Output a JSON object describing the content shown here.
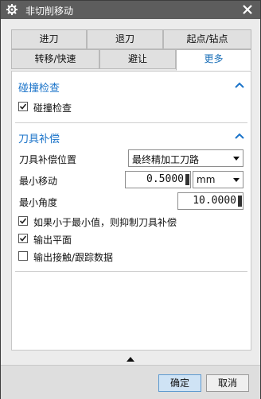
{
  "window": {
    "title": "非切削移动"
  },
  "icons": {
    "settings": "gear-icon",
    "close": "close-icon",
    "collapse": "chevron-up-icon",
    "dropdown": "chevron-down-icon"
  },
  "tabs": {
    "row1": [
      "进刀",
      "退刀",
      "起点/钻点"
    ],
    "row2": [
      "转移/快速",
      "避让",
      "更多"
    ],
    "active": "更多"
  },
  "collision_check": {
    "title": "碰撞检查",
    "checkbox_label": "碰撞检查",
    "checked": true
  },
  "tool_comp": {
    "title": "刀具补偿",
    "position_label": "刀具补偿位置",
    "position_value": "最终精加工刀路",
    "min_move_label": "最小移动",
    "min_move_value": "0.5000",
    "min_move_unit": "mm",
    "min_angle_label": "最小角度",
    "min_angle_value": "10.0000",
    "suppress_label": "如果小于最小值，则抑制刀具补偿",
    "suppress_checked": true,
    "output_plane_label": "输出平面",
    "output_plane_checked": true,
    "output_contact_label": "输出接触/跟踪数据",
    "output_contact_checked": false
  },
  "footer": {
    "ok_label": "确定",
    "cancel_label": "取消"
  },
  "colors": {
    "accent": "#1a73c9",
    "titlebar": "#5d5d5d",
    "panel": "#ffffff",
    "primary_button": "#cfe3f5"
  }
}
